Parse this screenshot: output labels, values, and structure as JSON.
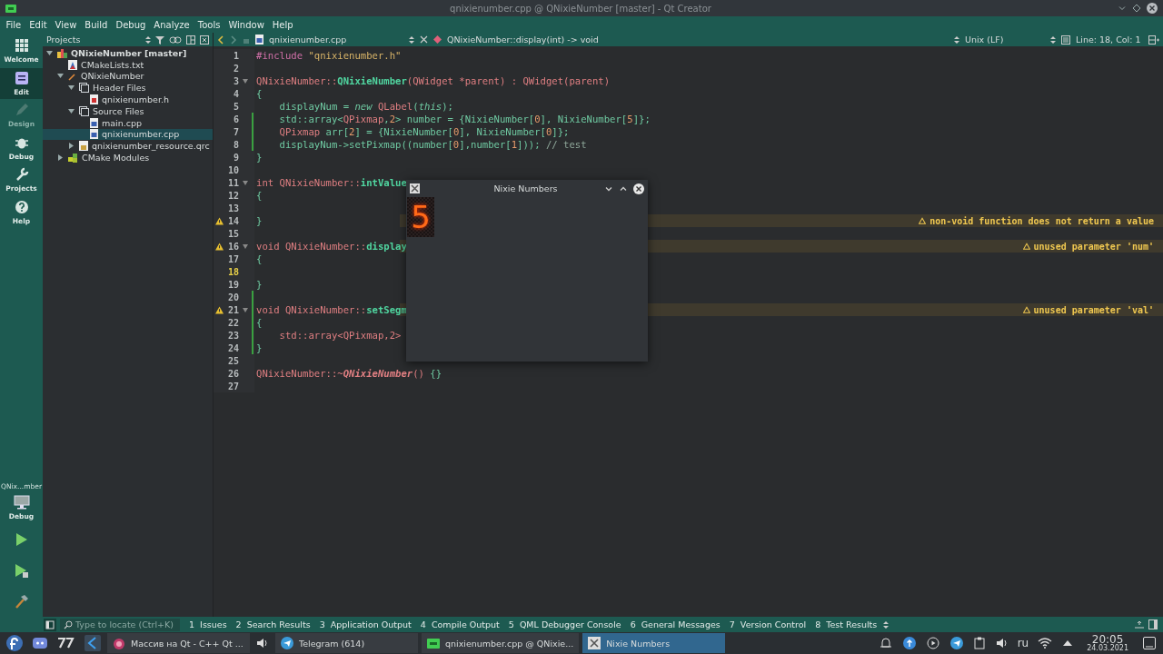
{
  "window": {
    "title": "qnixienumber.cpp @ QNixieNumber [master] - Qt Creator"
  },
  "menu": [
    "File",
    "Edit",
    "View",
    "Build",
    "Debug",
    "Analyze",
    "Tools",
    "Window",
    "Help"
  ],
  "modes": [
    {
      "label": "Welcome",
      "kind": "welcome",
      "selected": false,
      "disabled": false
    },
    {
      "label": "Edit",
      "kind": "edit",
      "selected": true,
      "disabled": false
    },
    {
      "label": "Design",
      "kind": "design",
      "selected": false,
      "disabled": true
    },
    {
      "label": "Debug",
      "kind": "debug",
      "selected": false,
      "disabled": false
    },
    {
      "label": "Projects",
      "kind": "projects",
      "selected": false,
      "disabled": false
    },
    {
      "label": "Help",
      "kind": "help",
      "selected": false,
      "disabled": false
    }
  ],
  "target": {
    "project": "QNix...mber",
    "config": "Debug"
  },
  "projects": {
    "title": "Projects",
    "tree": [
      {
        "label": "QNixieNumber [master]",
        "kind": "project",
        "expanded": true,
        "selected": false,
        "children": [
          {
            "label": "CMakeLists.txt",
            "kind": "cmake",
            "selected": false
          },
          {
            "label": "QNixieNumber",
            "kind": "target",
            "expanded": true,
            "selected": false,
            "children": [
              {
                "label": "Header Files",
                "kind": "folder",
                "expanded": true,
                "selected": false,
                "children": [
                  {
                    "label": "qnixienumber.h",
                    "kind": "header",
                    "selected": false
                  }
                ]
              },
              {
                "label": "Source Files",
                "kind": "folder",
                "expanded": true,
                "selected": false,
                "children": [
                  {
                    "label": "main.cpp",
                    "kind": "source",
                    "selected": false
                  },
                  {
                    "label": "qnixienumber.cpp",
                    "kind": "source",
                    "selected": true
                  }
                ]
              },
              {
                "label": "qnixienumber_resource.qrc",
                "kind": "qrc",
                "expanded": false,
                "selected": false
              }
            ]
          },
          {
            "label": "CMake Modules",
            "kind": "modules",
            "expanded": false,
            "selected": false
          }
        ]
      }
    ]
  },
  "editor": {
    "file": "qnixienumber.cpp",
    "symbol": "QNixieNumber::display(int) -> void",
    "line_ending": "Unix (LF)",
    "position": "Line: 18, Col: 1",
    "lines": [
      {
        "n": "1",
        "tokens": [
          {
            "kind": "pp",
            "text": "#include "
          },
          {
            "kind": "str",
            "text": "\"qnixienumber.h\""
          }
        ]
      },
      {
        "n": "2"
      },
      {
        "n": "3",
        "fold": true,
        "tokens": [
          {
            "kind": "type",
            "text": "QNixieNumber"
          },
          {
            "kind": "type",
            "text": "::"
          },
          {
            "kind": "fn",
            "text": "QNixieNumber"
          },
          {
            "kind": "type",
            "text": "(QWidget *parent) : QWidget(parent)"
          }
        ]
      },
      {
        "n": "4",
        "tokens": [
          {
            "kind": "plain",
            "text": "{"
          }
        ]
      },
      {
        "n": "5",
        "tokens": [
          {
            "kind": "plain",
            "text": "    displayNum = "
          },
          {
            "kind": "it",
            "text": "new"
          },
          {
            "kind": "type",
            "text": " QLabel"
          },
          {
            "kind": "plain",
            "text": "("
          },
          {
            "kind": "it",
            "text": "this"
          },
          {
            "kind": "plain",
            "text": ");"
          }
        ]
      },
      {
        "n": "6",
        "modified": true,
        "tokens": [
          {
            "kind": "plain",
            "text": "    std::array<"
          },
          {
            "kind": "type",
            "text": "QPixmap"
          },
          {
            "kind": "plain",
            "text": ","
          },
          {
            "kind": "num",
            "text": "2"
          },
          {
            "kind": "plain",
            "text": "> number = {NixieNumber["
          },
          {
            "kind": "num",
            "text": "0"
          },
          {
            "kind": "plain",
            "text": "], NixieNumber["
          },
          {
            "kind": "num",
            "text": "5"
          },
          {
            "kind": "plain",
            "text": "]};"
          }
        ]
      },
      {
        "n": "7",
        "modified": true,
        "tokens": [
          {
            "kind": "type",
            "text": "    QPixmap"
          },
          {
            "kind": "plain",
            "text": " arr["
          },
          {
            "kind": "num",
            "text": "2"
          },
          {
            "kind": "plain",
            "text": "] = {NixieNumber["
          },
          {
            "kind": "num",
            "text": "0"
          },
          {
            "kind": "plain",
            "text": "], NixieNumber["
          },
          {
            "kind": "num",
            "text": "0"
          },
          {
            "kind": "plain",
            "text": "]};"
          }
        ]
      },
      {
        "n": "8",
        "modified": true,
        "tokens": [
          {
            "kind": "plain",
            "text": "    displayNum->setPixmap((number["
          },
          {
            "kind": "num",
            "text": "0"
          },
          {
            "kind": "plain",
            "text": "],number["
          },
          {
            "kind": "num",
            "text": "1"
          },
          {
            "kind": "plain",
            "text": "])); "
          },
          {
            "kind": "comment",
            "text": "// test"
          }
        ]
      },
      {
        "n": "9",
        "tokens": [
          {
            "kind": "plain",
            "text": "}"
          }
        ]
      },
      {
        "n": "10"
      },
      {
        "n": "11",
        "fold": true,
        "tokens": [
          {
            "kind": "type",
            "text": "int QNixieNumber::"
          },
          {
            "kind": "fn",
            "text": "intValue"
          }
        ]
      },
      {
        "n": "12",
        "tokens": [
          {
            "kind": "plain",
            "text": "{"
          }
        ]
      },
      {
        "n": "13"
      },
      {
        "n": "14",
        "warning": "non-void function does not return a value",
        "tokens": [
          {
            "kind": "plain",
            "text": "}"
          }
        ]
      },
      {
        "n": "15"
      },
      {
        "n": "16",
        "fold": true,
        "warning": "unused parameter 'num'",
        "tokens": [
          {
            "kind": "type",
            "text": "void QNixieNumber::"
          },
          {
            "kind": "fn",
            "text": "display"
          }
        ]
      },
      {
        "n": "17",
        "tokens": [
          {
            "kind": "plain",
            "text": "{"
          }
        ]
      },
      {
        "n": "18",
        "current": true
      },
      {
        "n": "19",
        "tokens": [
          {
            "kind": "plain",
            "text": "}"
          }
        ]
      },
      {
        "n": "20",
        "modified": true
      },
      {
        "n": "21",
        "fold": true,
        "modified": true,
        "warning": "unused parameter 'val'",
        "tokens": [
          {
            "kind": "type",
            "text": "void QNixieNumber::"
          },
          {
            "kind": "fn",
            "text": "setSegm"
          }
        ]
      },
      {
        "n": "22",
        "modified": true,
        "tokens": [
          {
            "kind": "plain",
            "text": "{"
          }
        ]
      },
      {
        "n": "23",
        "modified": true,
        "tokens": [
          {
            "kind": "type",
            "text": "    std::array<QPixmap,2>"
          }
        ]
      },
      {
        "n": "24",
        "modified": true,
        "tokens": [
          {
            "kind": "plain",
            "text": "}"
          }
        ]
      },
      {
        "n": "25"
      },
      {
        "n": "26",
        "tokens": [
          {
            "kind": "type",
            "text": "QNixieNumber::~"
          },
          {
            "kind": "fnit",
            "text": "QNixieNumber"
          },
          {
            "kind": "type",
            "text": "()"
          },
          {
            "kind": "plain",
            "text": " {}"
          }
        ]
      },
      {
        "n": "27"
      }
    ]
  },
  "app_window": {
    "title": "Nixie Numbers",
    "digit": "5"
  },
  "output": {
    "placeholder": "Type to locate (Ctrl+K)",
    "tabs": [
      "1  Issues",
      "2  Search Results",
      "3  Application Output",
      "4  Compile Output",
      "5  QML Debugger Console",
      "6  General Messages",
      "7  Version Control",
      "8  Test Results"
    ]
  },
  "taskbar": {
    "tasks": [
      {
        "label": "Массив на Qt - C++ Qt ...",
        "kind": "browser",
        "selected": false
      },
      {
        "label": "Telegram (614)",
        "kind": "telegram",
        "selected": false
      },
      {
        "label": "qnixienumber.cpp @ QNixie...",
        "kind": "qt",
        "selected": false
      },
      {
        "label": "Nixie Numbers",
        "kind": "app",
        "selected": true
      }
    ],
    "language": "ru",
    "time": "20:05",
    "date": "24.03.2021"
  }
}
